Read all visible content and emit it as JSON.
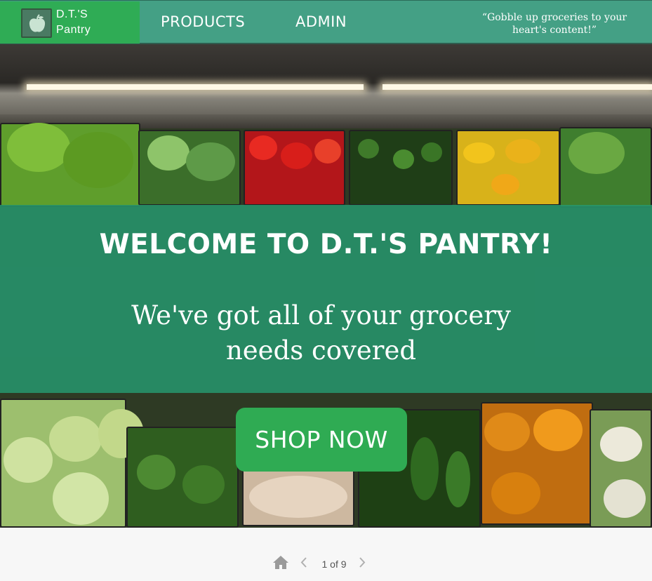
{
  "header": {
    "logo_line1": "D.T.'S",
    "logo_line2": "Pantry",
    "nav": [
      "PRODUCTS",
      "ADMIN"
    ],
    "tagline": "“Gobble up groceries to your heart's content!”"
  },
  "hero": {
    "title": "WELCOME TO D.T.'S PANTRY!",
    "subtitle": "We've got all of your grocery needs covered",
    "cta_label": "SHOP NOW"
  },
  "pager": {
    "current": 1,
    "total": 9,
    "indicator": "1 of 9"
  },
  "icons": {
    "logo": "apple-icon",
    "home": "home-icon",
    "prev": "chevron-left-icon",
    "next": "chevron-right-icon"
  },
  "colors": {
    "header_bg": "#44a085",
    "logo_bg": "#2fac55",
    "overlay": "#26966e",
    "button": "#2fab53"
  }
}
